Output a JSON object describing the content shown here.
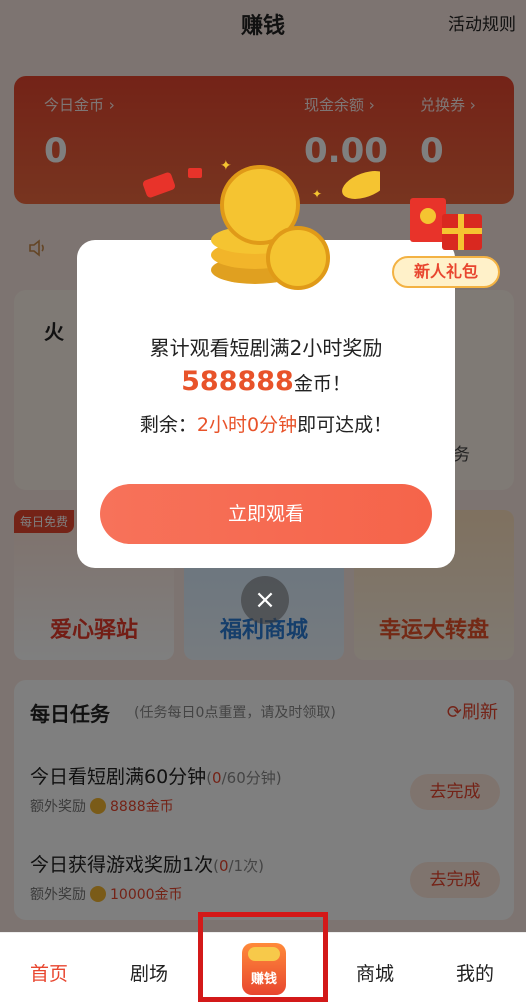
{
  "header": {
    "title": "赚钱",
    "rules": "活动规则"
  },
  "balance": {
    "gold_today_label": "今日金币 ›",
    "gold_today_value": "0",
    "cash_label": "现金余额 ›",
    "cash_value": "0.00",
    "voucher_label": "兑换券 ›",
    "voucher_value": "0"
  },
  "hot": {
    "title_partial": "火",
    "right_partial": "务"
  },
  "promos": {
    "p1_tag": "每日免费",
    "p1": "爱心驿站",
    "p2": "福利商城",
    "p3": "幸运大转盘"
  },
  "tasks": {
    "title": "每日任务",
    "note": "(任务每日0点重置，请及时领取)",
    "refresh": "⟳刷新",
    "items": [
      {
        "title": "今日看短剧满60分钟",
        "prog_done": "0",
        "prog_total": "/60分钟)",
        "prog_open": "(",
        "reward_label": "额外奖励",
        "reward": "8888金币",
        "button": "去完成"
      },
      {
        "title": "今日获得游戏奖励1次",
        "prog_done": "0",
        "prog_total": "/1次)",
        "prog_open": "(",
        "reward_label": "额外奖励",
        "reward": "10000金币",
        "button": "去完成"
      }
    ]
  },
  "modal": {
    "line1": "累计观看短剧满2小时奖励",
    "amount": "588888",
    "amount_unit": "金币！",
    "line3_prefix": "剩余：",
    "line3_time": "2小时0分钟",
    "line3_suffix": "即可达成！",
    "button": "立即观看",
    "close": "×"
  },
  "new_gift": "新人礼包",
  "nav": {
    "home": "首页",
    "drama": "剧场",
    "earn": "赚钱",
    "mall": "商城",
    "me": "我的"
  }
}
